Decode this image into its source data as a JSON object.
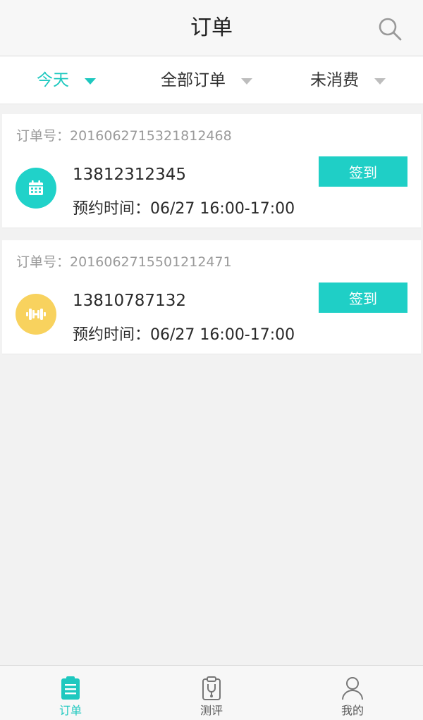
{
  "header": {
    "title": "订单",
    "search_icon": "search-icon"
  },
  "filters": [
    {
      "label": "今天",
      "active": true
    },
    {
      "label": "全部订单",
      "active": false
    },
    {
      "label": "未消费",
      "active": false
    }
  ],
  "orders": [
    {
      "order_label": "订单号：",
      "order_no": "2016062715321812468",
      "phone": "13812312345",
      "time_label": "预约时间：",
      "time": "06/27 16:00-17:00",
      "icon": "calendar-icon",
      "icon_color": "#20d2c9",
      "action": "签到"
    },
    {
      "order_label": "订单号：",
      "order_no": "2016062715501212471",
      "phone": "13810787132",
      "time_label": "预约时间：",
      "time": "06/27 16:00-17:00",
      "icon": "dumbbell-icon",
      "icon_color": "#f8d25e",
      "action": "签到"
    }
  ],
  "tabbar": {
    "items": [
      {
        "label": "订单",
        "icon": "clipboard-list-icon",
        "active": true
      },
      {
        "label": "测评",
        "icon": "clipboard-stethoscope-icon",
        "active": false
      },
      {
        "label": "我的",
        "icon": "user-icon",
        "active": false
      }
    ]
  },
  "colors": {
    "accent": "#1ec8bf",
    "background": "#f2f2f2",
    "card": "#ffffff"
  }
}
